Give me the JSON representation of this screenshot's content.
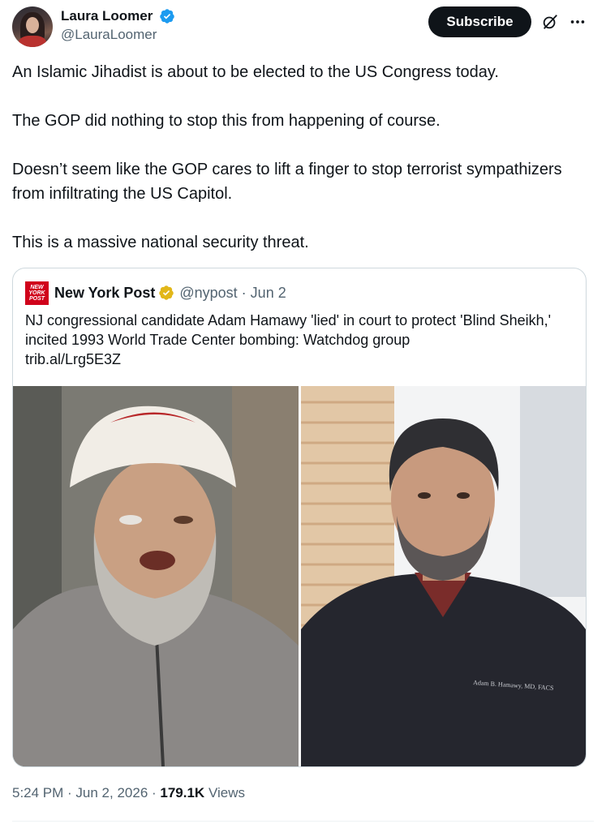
{
  "author": {
    "display_name": "Laura Loomer",
    "handle": "@LauraLoomer",
    "avatar_icon": "profile-photo",
    "verified_icon": "blue-verified-badge"
  },
  "header": {
    "subscribe_label": "Subscribe",
    "grok_icon": "grok-icon",
    "more_icon": "more-horizontal-icon"
  },
  "tweet": {
    "paragraphs": [
      "An Islamic Jihadist is about to be elected to the US Congress today.",
      "The GOP did nothing to stop this from happening of course.",
      "Doesn’t seem like the GOP cares to lift a finger to stop terrorist sympathizers from infiltrating the US Capitol.",
      "This is a massive national security threat."
    ]
  },
  "quote": {
    "logo_text": "NEW YORK POST",
    "name": "New York Post",
    "handle_date": "@nypost · Jun 2",
    "text": "NJ congressional candidate Adam Hamawy 'lied' in court to protect 'Blind Sheikh,' incited 1993 World Trade Center bombing: Watchdog group",
    "link": "trib.al/Lrg5E3Z",
    "badge_icon": "gold-verified-badge",
    "scrub_label": "Adam B. Hamawy, MD, FACS"
  },
  "footer": {
    "time_date": "5:24 PM · Jun 2, 2026 · ",
    "views_count": "179.1K",
    "views_label": " Views"
  },
  "colors": {
    "text_primary": "#0f1419",
    "text_secondary": "#536471",
    "verified_blue": "#1d9bf0",
    "verified_gold": "#e2b719",
    "nypost_red": "#d0021b",
    "border": "#cfd9de"
  }
}
